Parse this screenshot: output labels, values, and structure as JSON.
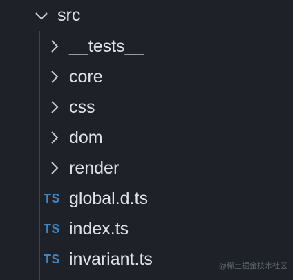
{
  "explorer": {
    "root": {
      "label": "src",
      "icon": "chevron-down-icon"
    },
    "folders": [
      {
        "label": "__tests__",
        "icon": "chevron-right-icon"
      },
      {
        "label": "core",
        "icon": "chevron-right-icon"
      },
      {
        "label": "css",
        "icon": "chevron-right-icon"
      },
      {
        "label": "dom",
        "icon": "chevron-right-icon"
      },
      {
        "label": "render",
        "icon": "chevron-right-icon"
      }
    ],
    "files": [
      {
        "label": "global.d.ts",
        "badge": "TS"
      },
      {
        "label": "index.ts",
        "badge": "TS"
      },
      {
        "label": "invariant.ts",
        "badge": "TS"
      }
    ]
  },
  "watermark": "@稀土掘金技术社区",
  "colors": {
    "background": "#1e2128",
    "text": "#dfe2e7",
    "ts_badge": "#3d86c6",
    "guide": "#3f4650"
  }
}
